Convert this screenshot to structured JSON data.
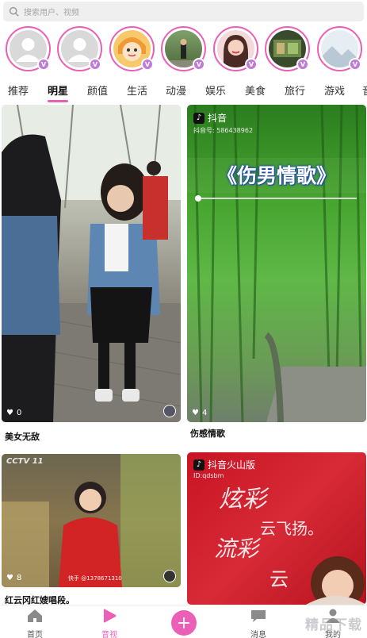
{
  "search": {
    "placeholder": "搜索用户、视频"
  },
  "avatars": [
    {
      "name": "avatar-1",
      "kind": "generic"
    },
    {
      "name": "avatar-2",
      "kind": "generic"
    },
    {
      "name": "avatar-3",
      "kind": "cartoon"
    },
    {
      "name": "avatar-4",
      "kind": "photo"
    },
    {
      "name": "avatar-5",
      "kind": "photo"
    },
    {
      "name": "avatar-6",
      "kind": "photo"
    },
    {
      "name": "avatar-7",
      "kind": "photo"
    }
  ],
  "badge_glyph": "V",
  "tabs": [
    "推荐",
    "明星",
    "颜值",
    "生活",
    "动漫",
    "娱乐",
    "美食",
    "旅行",
    "游戏",
    "音"
  ],
  "active_tab": "明星",
  "cards": [
    {
      "caption": "美女无敌",
      "likes": "0"
    },
    {
      "caption": "伤感情歌",
      "likes": "4",
      "app": "抖音",
      "tk_id": "抖音号: 586438962",
      "overlay_title": "《伤男情歌》"
    },
    {
      "caption": "红云冈红嫂唱段。",
      "likes": "8",
      "logo": "CCTV 11",
      "kuaishou": "快手 @1378671310"
    },
    {
      "caption": "",
      "likes": "",
      "app": "抖音火山版",
      "tk_id": "ID:qdsbm",
      "overlay_line1": "炫彩",
      "overlay_line2": "云飞扬。",
      "overlay_line3": "流彩",
      "overlay_line4": "云"
    }
  ],
  "nav": [
    {
      "label": "首页",
      "icon": "home-icon"
    },
    {
      "label": "音视",
      "icon": "video-play-icon"
    },
    {
      "label": "",
      "icon": "plus-icon"
    },
    {
      "label": "消息",
      "icon": "message-icon"
    },
    {
      "label": "我的",
      "icon": "profile-icon"
    }
  ],
  "watermark": "精品下载",
  "colors": {
    "accent": "#ec5fb7",
    "badge": "#c27ad8"
  }
}
